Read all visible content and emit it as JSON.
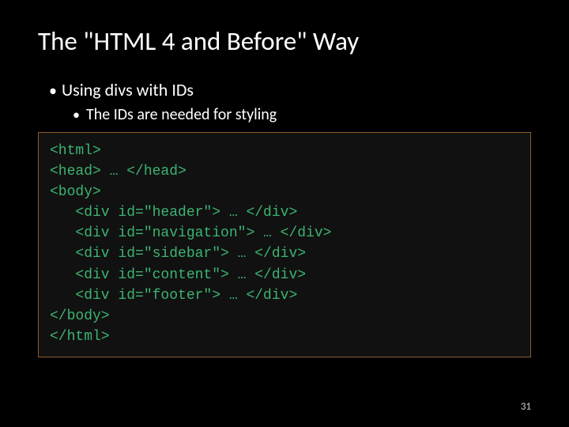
{
  "title": "The \"HTML 4 and Before\" Way",
  "bullets": {
    "l1": "Using divs with IDs",
    "l2": "The IDs are needed for styling"
  },
  "code": {
    "open_html": "<html>",
    "head": "<head> … </head>",
    "open_body": "<body>",
    "div_header": "   <div id=\"header\"> … </div>",
    "div_nav": "   <div id=\"navigation\"> … </div>",
    "div_side": "   <div id=\"sidebar\"> … </div>",
    "div_cont": "   <div id=\"content\"> … </div>",
    "div_foot": "   <div id=\"footer\"> … </div>",
    "close_body": "</body>",
    "close_html": "</html>"
  },
  "page_number": "31"
}
